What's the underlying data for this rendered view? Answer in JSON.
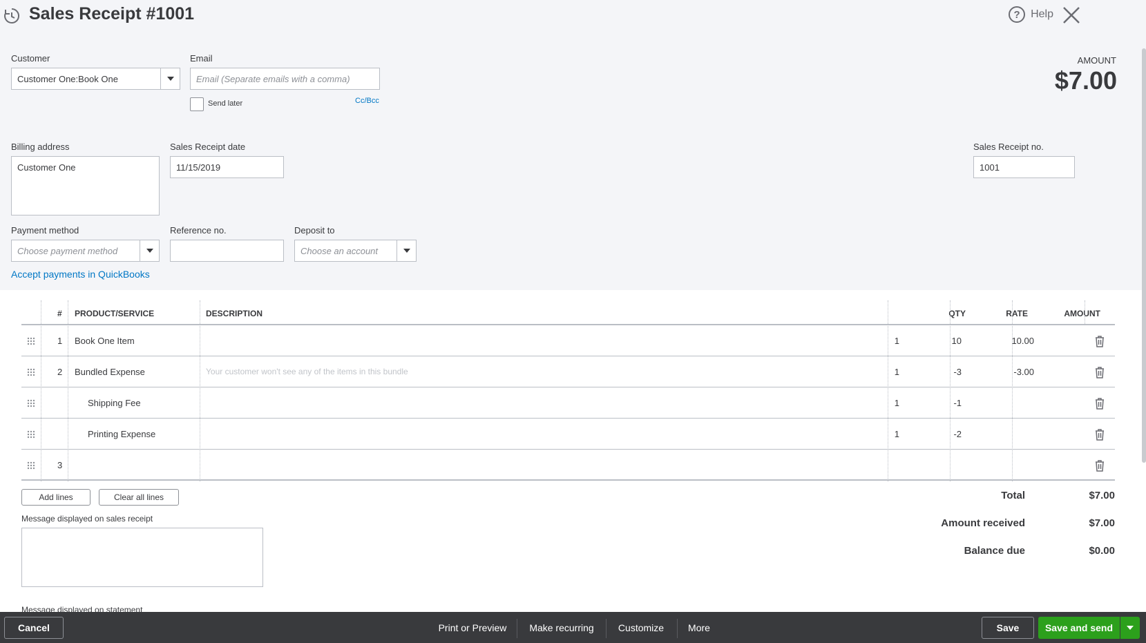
{
  "header": {
    "title": "Sales Receipt #1001",
    "help_label": "Help"
  },
  "form": {
    "customer_label": "Customer",
    "customer_value": "Customer One:Book One",
    "email_label": "Email",
    "email_placeholder": "Email (Separate emails with a comma)",
    "send_later_label": "Send later",
    "cc_bcc_label": "Cc/Bcc",
    "amount_label": "AMOUNT",
    "amount_value": "$7.00",
    "billing_label": "Billing address",
    "billing_value": "Customer One",
    "date_label": "Sales Receipt date",
    "date_value": "11/15/2019",
    "receipt_no_label": "Sales Receipt no.",
    "receipt_no_value": "1001",
    "payment_label": "Payment method",
    "payment_placeholder": "Choose payment method",
    "reference_label": "Reference no.",
    "reference_value": "",
    "deposit_label": "Deposit to",
    "deposit_placeholder": "Choose an account",
    "accept_payments_link": "Accept payments in QuickBooks"
  },
  "table": {
    "columns": [
      "#",
      "PRODUCT/SERVICE",
      "DESCRIPTION",
      "QTY",
      "RATE",
      "AMOUNT"
    ],
    "rows": [
      {
        "num": "1",
        "product": "Book One Item",
        "description": "",
        "qty": "1",
        "rate": "10",
        "amount": "10.00"
      },
      {
        "num": "2",
        "product": "Bundled Expense",
        "description": "Your customer won't see any of the items in this bundle",
        "qty": "1",
        "rate": "-3",
        "amount": "-3.00"
      },
      {
        "num": "",
        "product": "Shipping Fee",
        "description": "",
        "qty": "1",
        "rate": "-1",
        "amount": ""
      },
      {
        "num": "",
        "product": "Printing Expense",
        "description": "",
        "qty": "1",
        "rate": "-2",
        "amount": ""
      },
      {
        "num": "3",
        "product": "",
        "description": "",
        "qty": "",
        "rate": "",
        "amount": ""
      }
    ],
    "add_lines_label": "Add lines",
    "clear_lines_label": "Clear all lines"
  },
  "totals": {
    "total_label": "Total",
    "total_value": "$7.00",
    "received_label": "Amount received",
    "received_value": "$7.00",
    "balance_label": "Balance due",
    "balance_value": "$0.00"
  },
  "messages": {
    "receipt_label": "Message displayed on sales receipt",
    "statement_label": "Message displayed on statement"
  },
  "footer": {
    "cancel_label": "Cancel",
    "print_label": "Print or Preview",
    "recurring_label": "Make recurring",
    "customize_label": "Customize",
    "more_label": "More",
    "save_label": "Save",
    "save_send_label": "Save and send"
  },
  "colors": {
    "accent_green": "#2ca01c",
    "link_blue": "#0077c5",
    "footer_bg": "#393a3d",
    "top_bg": "#f4f5f8"
  }
}
